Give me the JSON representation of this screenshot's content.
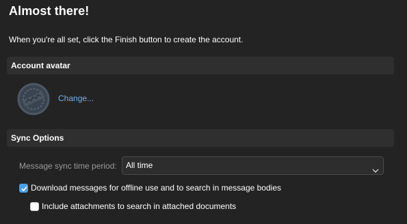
{
  "header": {
    "title": "Almost there!",
    "subtitle": "When you're all set, click the Finish button to create the account."
  },
  "avatar_section": {
    "heading": "Account avatar",
    "change_label": "Change...",
    "avatar_icon": "avatar-placeholder-icon"
  },
  "sync_section": {
    "heading": "Sync Options",
    "period_label": "Message sync time period:",
    "period_value": "All time",
    "dropdown_icon": "chevron-down-icon",
    "download_label": "Download messages for offline use and to search in message bodies",
    "download_checked": true,
    "attachments_label": "Include attachments to search in attached documents",
    "attachments_checked": false
  },
  "colors": {
    "background": "#232323",
    "section_header": "#2f2f2f",
    "link": "#6fb0ee",
    "accent": "#4aa0e8",
    "muted_text": "#9a9a9a"
  }
}
